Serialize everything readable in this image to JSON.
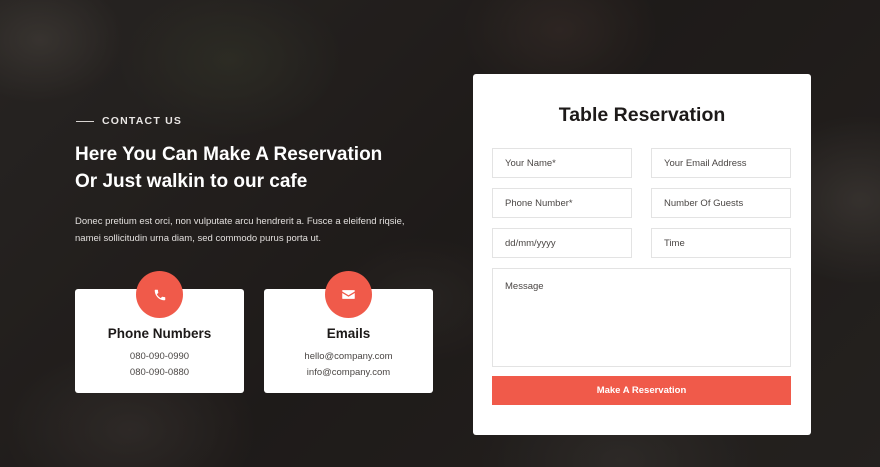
{
  "contact": {
    "eyebrow": "CONTACT US",
    "headline_line1": "Here You Can Make A Reservation",
    "headline_line2": "Or Just walkin to our cafe",
    "description": "Donec pretium est orci, non vulputate arcu hendrerit a. Fusce a eleifend riqsie, namei sollicitudin urna diam, sed commodo purus porta ut."
  },
  "cards": {
    "phone": {
      "icon": "phone-icon",
      "title": "Phone Numbers",
      "line1": "080-090-0990",
      "line2": "080-090-0880"
    },
    "email": {
      "icon": "envelope-icon",
      "title": "Emails",
      "line1": "hello@company.com",
      "line2": "info@company.com"
    }
  },
  "form": {
    "title": "Table Reservation",
    "name_placeholder": "Your Name*",
    "email_placeholder": "Your Email Address",
    "phone_placeholder": "Phone Number*",
    "guests_placeholder": "Number Of Guests",
    "date_placeholder": "dd/mm/yyyy",
    "time_placeholder": "Time",
    "message_placeholder": "Message",
    "submit_label": "Make A Reservation"
  },
  "colors": {
    "accent": "#f05a4a",
    "card_bg": "#ffffff",
    "overlay": "#2a2625"
  }
}
